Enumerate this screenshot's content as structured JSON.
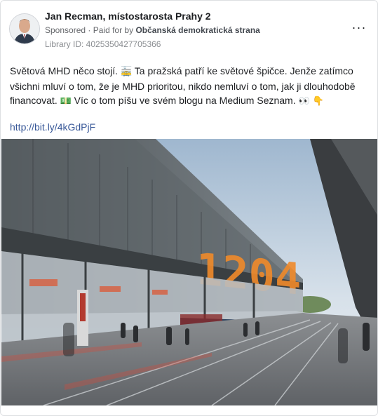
{
  "post": {
    "page_name": "Jan Recman, místostarosta Prahy 2",
    "sponsored_label": "Sponsored",
    "paid_for_prefix": "· Paid for by",
    "paid_for_by": "Občanská demokratická strana",
    "library_id": "Library ID: 4025350427705366",
    "more_icon": "more-horizontal-icon",
    "text_parts": {
      "p1": "Světová MHD něco stojí. ",
      "emoji_tram": "🚋",
      "p2": " Ta pražská patří ke světové špičce. Jenže zatímco všichni mluví o tom, že je MHD prioritou, nikdo nemluví o tom, jak ji dlouhodobě financovat. ",
      "emoji_money": "💵",
      "p3": " Víc o tom píšu ve svém blogu na Medium Seznam. ",
      "emoji_eyes": "👀",
      "emoji_point": "👇"
    },
    "link": "http://bit.ly/4kGdPjF",
    "image_sign": "1204",
    "colors": {
      "link": "#385898",
      "meta": "#65676b",
      "sign": "#f08a2a"
    }
  }
}
